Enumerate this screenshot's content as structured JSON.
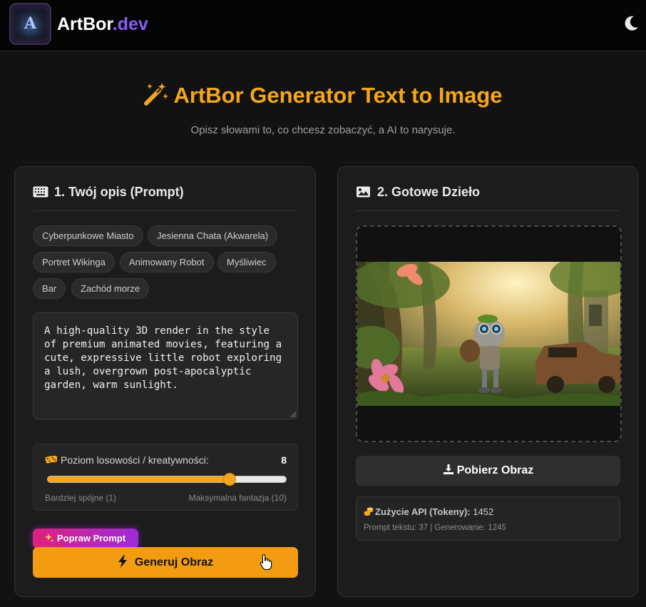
{
  "header": {
    "brand_main": "ArtBor",
    "brand_suffix": ".dev",
    "logo_letter": "A",
    "theme_toggle_icon": "moon-icon"
  },
  "hero": {
    "title": "ArtBor Generator Text to Image",
    "subtitle": "Opisz słowami to, co chcesz zobaczyć, a AI to narysuje.",
    "icon": "magic-wand-icon"
  },
  "prompt_panel": {
    "title": "1. Twój opis (Prompt)",
    "icon": "keyboard-icon",
    "chips": [
      "Cyberpunkowe Miasto",
      "Jesienna Chata (Akwarela)",
      "Portret Wikinga",
      "Animowany Robot",
      "Myśliwiec",
      "Bar",
      "Zachód morze"
    ],
    "prompt_text": "A high-quality 3D render in the style of premium animated movies, featuring a cute, expressive little robot exploring a lush, overgrown post-apocalyptic garden, warm sunlight.",
    "slider": {
      "label": "Poziom losowości / kreatywności:",
      "value": 8,
      "min": 1,
      "max": 10,
      "min_label": "Bardziej spójne (1)",
      "max_label": "Maksymalna fantazja (10)"
    },
    "improve_button": "Popraw Prompt",
    "generate_button": "Generuj Obraz",
    "colors": {
      "accent": "#f39c12",
      "improve_gradient_start": "#e0207e",
      "improve_gradient_end": "#9d2cd8"
    }
  },
  "result_panel": {
    "title": "2. Gotowe Dzieło",
    "icon": "image-icon",
    "download_button": "Pobierz Obraz",
    "usage": {
      "label": "Zużycie API (Tokeny):",
      "total": "1452",
      "details": "Prompt tekstu: 37 | Generowanie: 1245"
    }
  }
}
